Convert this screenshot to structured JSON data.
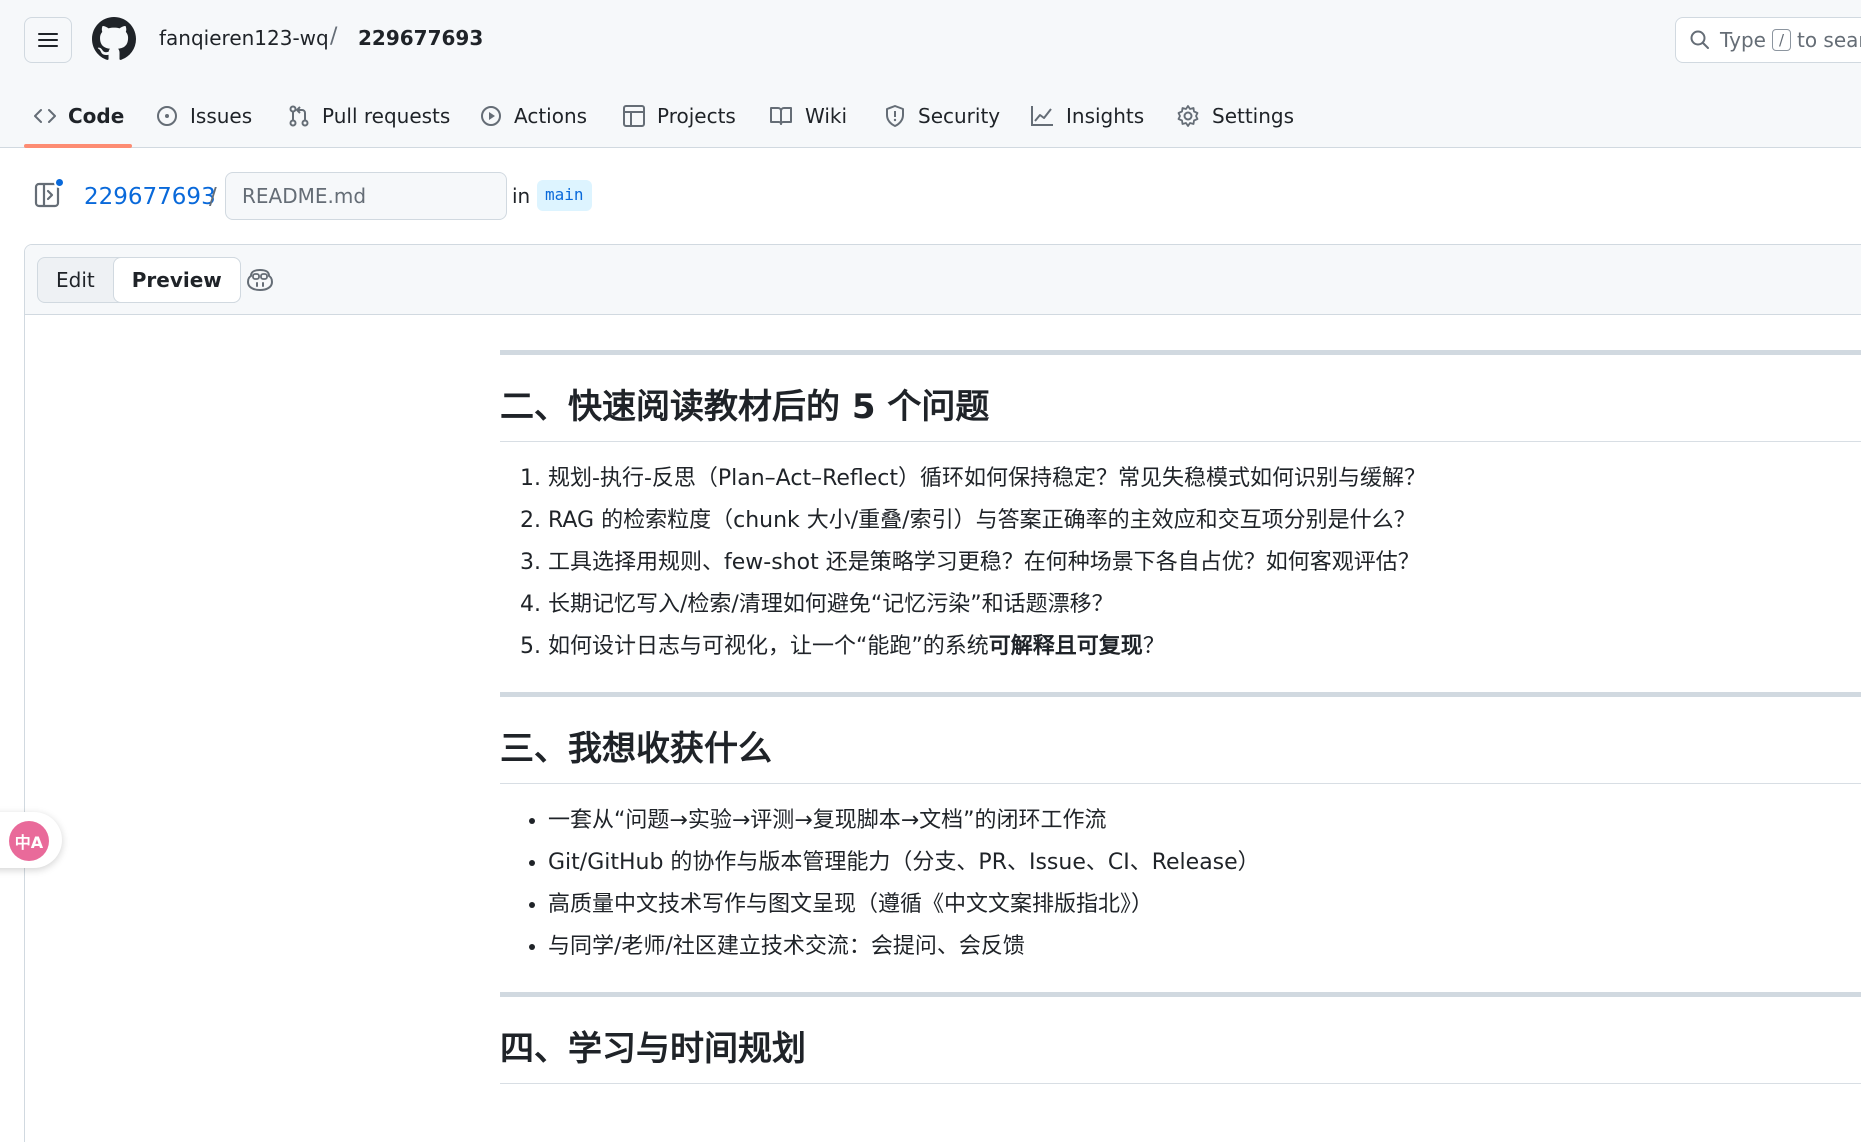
{
  "header": {
    "owner": "fanqieren123-wq",
    "separator": "/",
    "repo": "229677693",
    "search": {
      "prefix": "Type",
      "key": "/",
      "suffix": "to search"
    }
  },
  "nav": {
    "tabs": [
      {
        "label": "Code",
        "icon": "code-icon",
        "active": true
      },
      {
        "label": "Issues",
        "icon": "issue-icon"
      },
      {
        "label": "Pull requests",
        "icon": "pull-request-icon"
      },
      {
        "label": "Actions",
        "icon": "play-icon"
      },
      {
        "label": "Projects",
        "icon": "table-icon"
      },
      {
        "label": "Wiki",
        "icon": "book-icon"
      },
      {
        "label": "Security",
        "icon": "shield-icon"
      },
      {
        "label": "Insights",
        "icon": "graph-icon"
      },
      {
        "label": "Settings",
        "icon": "gear-icon"
      }
    ],
    "active_color": "#fd8c73"
  },
  "file": {
    "repo": "229677693",
    "separator": "/",
    "filename": "README.md",
    "in_label": "in",
    "branch": "main"
  },
  "editor": {
    "tabs": {
      "edit": "Edit",
      "preview": "Preview"
    },
    "selected_tab": "Preview"
  },
  "content": {
    "section2": {
      "heading": "二、快速阅读教材后的 5 个问题",
      "items": [
        "规划-执行-反思（Plan–Act–Reflect）循环如何保持稳定？常见失稳模式如何识别与缓解？",
        "RAG 的检索粒度（chunk 大小/重叠/索引）与答案正确率的主效应和交互项分别是什么？",
        "工具选择用规则、few-shot 还是策略学习更稳？在何种场景下各自占优？如何客观评估？",
        "长期记忆写入/检索/清理如何避免“记忆污染”和话题漂移？"
      ],
      "item5_prefix": "如何设计日志与可视化，让一个“能跑”的系统",
      "item5_bold": "可解释且可复现",
      "item5_suffix": "？"
    },
    "section3": {
      "heading": "三、我想收获什么",
      "items": [
        "一套从“问题→实验→评测→复现脚本→文档”的闭环工作流",
        "Git/GitHub 的协作与版本管理能力（分支、PR、Issue、CI、Release）",
        "高质量中文技术写作与图文呈现（遵循《中文文案排版指北》）",
        "与同学/老师/社区建立技术交流：会提问、会反馈"
      ]
    },
    "section4": {
      "heading": "四、学习与时间规划"
    }
  },
  "translate_badge": {
    "label": "中A"
  },
  "colors": {
    "link": "#0969da",
    "border": "#d1d9e0",
    "header_bg": "#f6f8fa"
  }
}
